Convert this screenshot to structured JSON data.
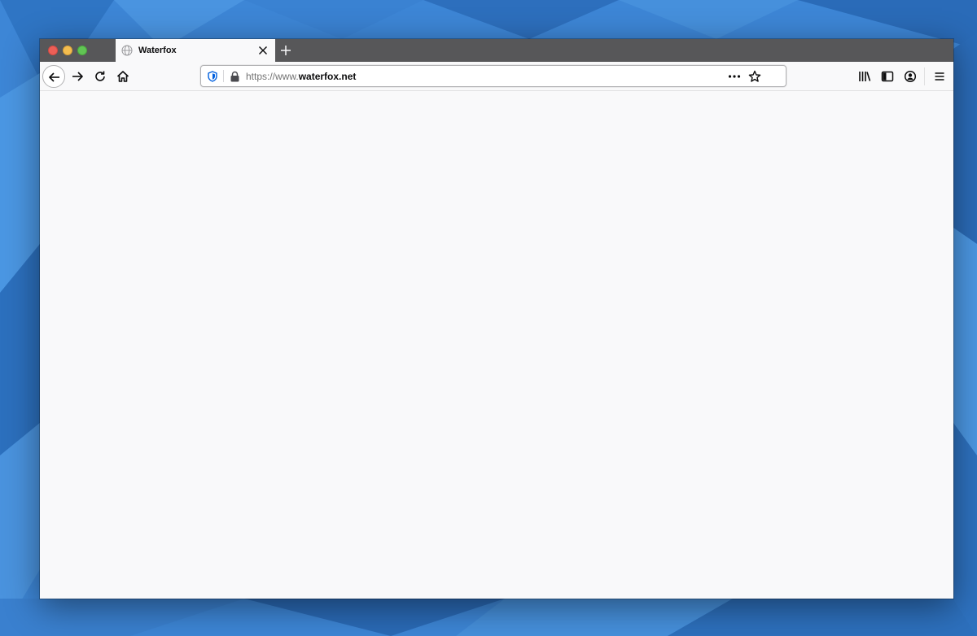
{
  "tab": {
    "title": "Waterfox",
    "favicon": "globe-icon"
  },
  "urlbar": {
    "url_scheme_prefix": "https://www.",
    "url_host": "waterfox.net"
  },
  "icons": {
    "back": "arrow-left-icon",
    "forward": "arrow-right-icon",
    "reload": "reload-icon",
    "home": "home-icon",
    "tracking_protection": "shield-icon",
    "site_security": "lock-icon",
    "page_actions": "more-icon",
    "bookmark": "star-icon",
    "library": "library-icon",
    "sidebar": "sidebar-icon",
    "account": "account-icon",
    "menu": "hamburger-menu-icon",
    "tab_close": "close-icon",
    "new_tab": "plus-icon"
  },
  "colors": {
    "tabbar_background": "#575759",
    "toolbar_background": "#f9f9fa",
    "close_button": "#ec5f57",
    "minimize_button": "#f4bd4f",
    "maximize_button": "#61c554",
    "shield_accent": "#0060df",
    "wallpaper_blue": "#3d86d6"
  }
}
